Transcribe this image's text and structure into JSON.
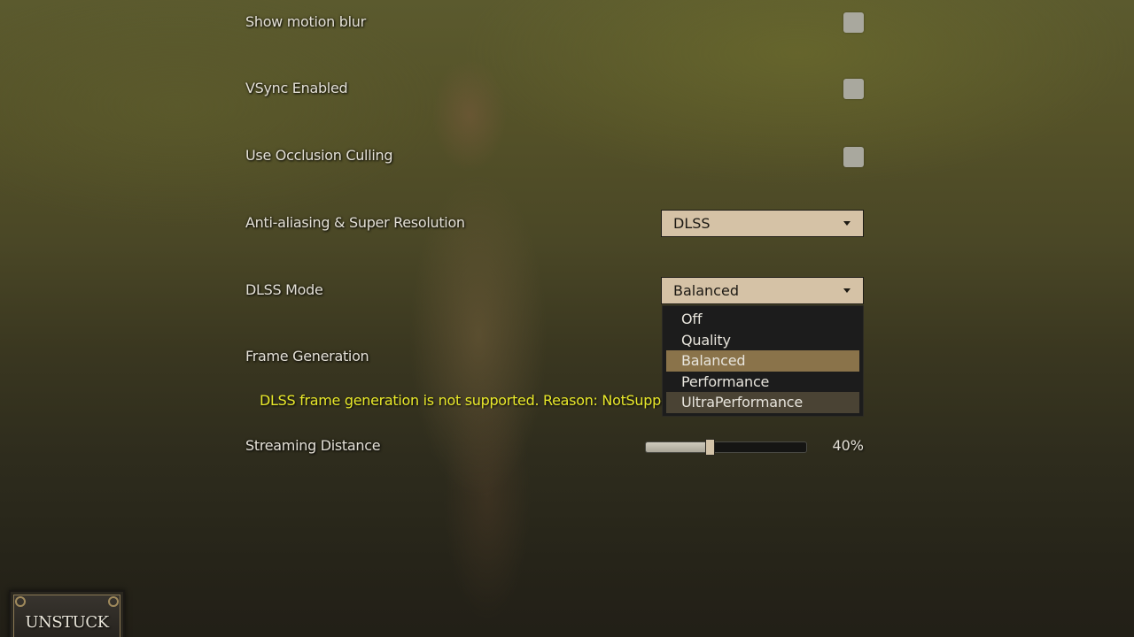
{
  "settings": {
    "motion_blur": {
      "label": "Show motion blur",
      "checked": false
    },
    "vsync": {
      "label": "VSync Enabled",
      "checked": false
    },
    "occlusion_culling": {
      "label": "Use Occlusion Culling",
      "checked": false
    },
    "anti_aliasing": {
      "label": "Anti-aliasing & Super Resolution",
      "value": "DLSS"
    },
    "dlss_mode": {
      "label": "DLSS Mode",
      "value": "Balanced",
      "options": [
        "Off",
        "Quality",
        "Balanced",
        "Performance",
        "UltraPerformance"
      ],
      "selected_index": 2,
      "hovered_index": 4
    },
    "frame_generation": {
      "label": "Frame Generation",
      "warning": "DLSS frame generation is not supported. Reason: NotSupportedIncompatibleHardware"
    },
    "streaming_distance": {
      "label": "Streaming Distance",
      "value_percent": 40,
      "value_text": "40%"
    }
  },
  "buttons": {
    "unstuck": "UNSTUCK"
  },
  "colors": {
    "dropdown_bg": "#d5c2a6",
    "selected_option": "#8a734a",
    "hovered_option": "#4a4334",
    "warning_text": "#e8e82a",
    "checkbox": "#a9a89e"
  }
}
